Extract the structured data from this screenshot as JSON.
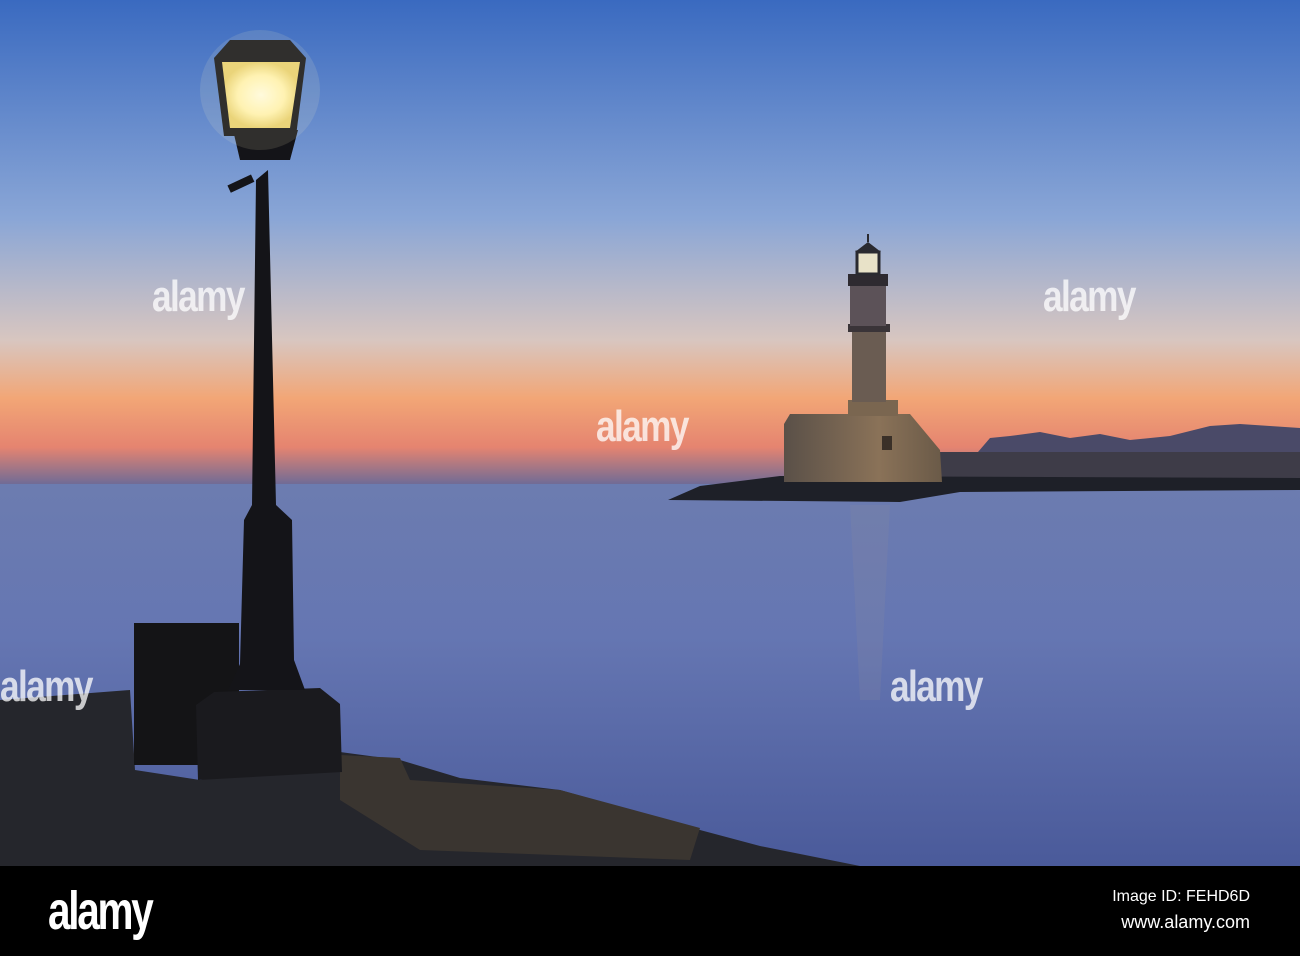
{
  "photo": {
    "subject": "lighthouse-at-dusk",
    "colors": {
      "sky_top": "#3a6ac0",
      "horizon_glow": "#f0a070",
      "sea": "#5e6eac"
    }
  },
  "watermark": {
    "text": "alamy"
  },
  "footer": {
    "logo": "alamy",
    "image_id": "Image ID: FEHD6D",
    "website": "www.alamy.com"
  }
}
